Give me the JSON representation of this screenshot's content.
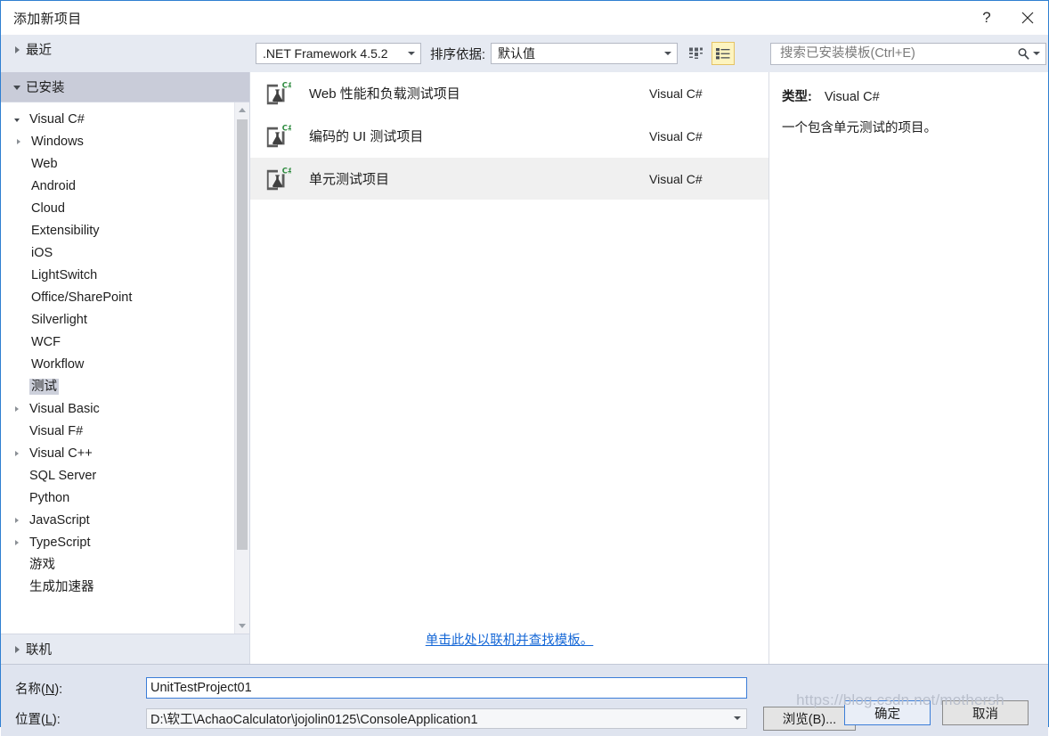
{
  "window": {
    "title": "添加新项目",
    "help_icon": "help-icon",
    "help_glyph": "?",
    "close_icon": "close-icon",
    "close_glyph": "✕"
  },
  "left_panel": {
    "groups": [
      {
        "label": "最近",
        "expanded": false,
        "selected": false
      },
      {
        "label": "已安装",
        "expanded": true,
        "selected": true
      }
    ],
    "online_group": {
      "label": "联机",
      "expanded": false
    },
    "tree": [
      {
        "label": "Visual C#",
        "level": 0,
        "expander": "down",
        "selected": false
      },
      {
        "label": "Windows",
        "level": 1,
        "expander": "right",
        "selected": false
      },
      {
        "label": "Web",
        "level": 1,
        "expander": "none",
        "selected": false
      },
      {
        "label": "Android",
        "level": 1,
        "expander": "none",
        "selected": false
      },
      {
        "label": "Cloud",
        "level": 1,
        "expander": "none",
        "selected": false
      },
      {
        "label": "Extensibility",
        "level": 1,
        "expander": "none",
        "selected": false
      },
      {
        "label": "iOS",
        "level": 1,
        "expander": "none",
        "selected": false
      },
      {
        "label": "LightSwitch",
        "level": 1,
        "expander": "none",
        "selected": false
      },
      {
        "label": "Office/SharePoint",
        "level": 1,
        "expander": "none",
        "selected": false
      },
      {
        "label": "Silverlight",
        "level": 1,
        "expander": "none",
        "selected": false
      },
      {
        "label": "WCF",
        "level": 1,
        "expander": "none",
        "selected": false
      },
      {
        "label": "Workflow",
        "level": 1,
        "expander": "none",
        "selected": false
      },
      {
        "label": "测试",
        "level": 1,
        "expander": "none",
        "selected": true
      },
      {
        "label": "Visual Basic",
        "level": 0,
        "expander": "right",
        "selected": false
      },
      {
        "label": "Visual F#",
        "level": 0,
        "expander": "none",
        "selected": false
      },
      {
        "label": "Visual C++",
        "level": 0,
        "expander": "right",
        "selected": false
      },
      {
        "label": "SQL Server",
        "level": 0,
        "expander": "none",
        "selected": false
      },
      {
        "label": "Python",
        "level": 0,
        "expander": "none",
        "selected": false
      },
      {
        "label": "JavaScript",
        "level": 0,
        "expander": "right",
        "selected": false
      },
      {
        "label": "TypeScript",
        "level": 0,
        "expander": "right",
        "selected": false
      },
      {
        "label": "游戏",
        "level": 0,
        "expander": "none",
        "selected": false
      },
      {
        "label": "生成加速器",
        "level": 0,
        "expander": "none",
        "selected": false
      }
    ]
  },
  "toolbar": {
    "framework_value": ".NET Framework 4.5.2",
    "sort_label": "排序依据:",
    "sort_value": "默认值",
    "view_tiles_icon": "tiles-view-icon",
    "view_list_icon": "list-view-icon",
    "view_active": "list"
  },
  "search": {
    "placeholder": "搜索已安装模板(Ctrl+E)",
    "value": "",
    "icon": "search-icon",
    "dropdown_icon": "chevron-down-icon"
  },
  "templates": {
    "items": [
      {
        "name": "Web 性能和负载测试项目",
        "language": "Visual C#",
        "icon": "csharp-test-project-icon",
        "selected": false
      },
      {
        "name": "编码的 UI 测试项目",
        "language": "Visual C#",
        "icon": "csharp-test-project-icon",
        "selected": false
      },
      {
        "name": "单元测试项目",
        "language": "Visual C#",
        "icon": "csharp-test-project-icon",
        "selected": true
      }
    ],
    "online_link": "单击此处以联机并查找模板。"
  },
  "details": {
    "type_label": "类型:",
    "type_value": "Visual C#",
    "description": "一个包含单元测试的项目。"
  },
  "form": {
    "name_label_prefix": "名称(",
    "name_label_key": "N",
    "name_label_suffix": "):",
    "name_value": "UnitTestProject01",
    "location_label_prefix": "位置(",
    "location_label_key": "L",
    "location_label_suffix": "):",
    "location_value": "D:\\软工\\AchaoCalculator\\jojolin0125\\ConsoleApplication1",
    "browse_label": "浏览(B)...",
    "ok_label": "确定",
    "cancel_label": "取消"
  },
  "watermark": {
    "text": "https://blog.csdn.net/mothersh"
  },
  "colors": {
    "accent": "#3b7dd8",
    "panel_bg": "#e6eaf2",
    "bottom_bg": "#dfe4ef",
    "selected_row": "#f0f0f0",
    "link": "#1366d6",
    "active_view_bg": "#fdf4bf"
  }
}
